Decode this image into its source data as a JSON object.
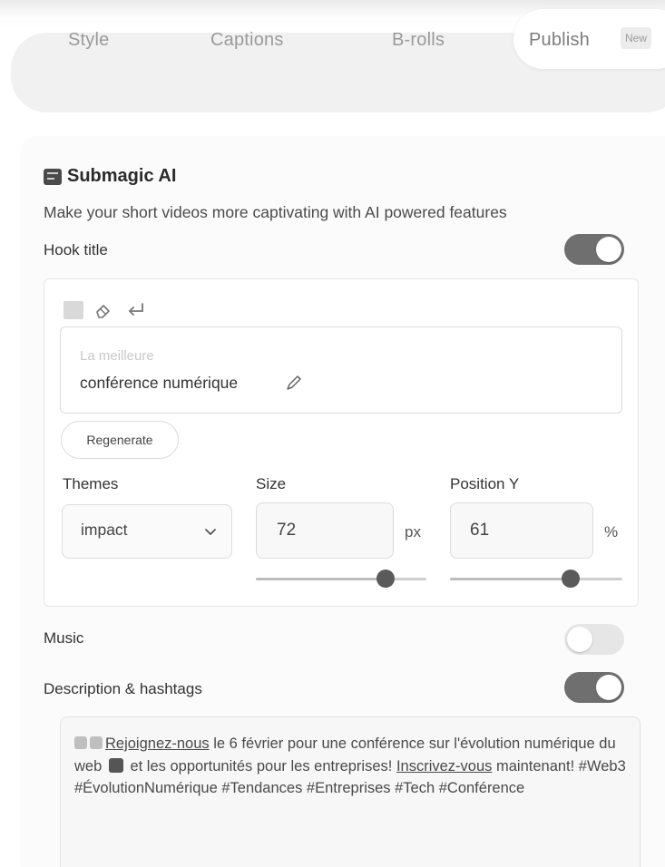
{
  "tabs": {
    "style": "Style",
    "captions": "Captions",
    "brolls": "B-rolls",
    "publish": "Publish",
    "publish_badge": "New"
  },
  "ai": {
    "title": "Submagic AI",
    "subtitle": "Make your short videos more captivating with AI powered features"
  },
  "hook": {
    "label": "Hook title",
    "enabled": true,
    "line1": "La meilleure",
    "line2": "conférence numérique",
    "regenerate": "Regenerate",
    "themes_label": "Themes",
    "theme_value": "impact",
    "size_label": "Size",
    "size_value": "72",
    "size_unit": "px",
    "size_slider": 0.76,
    "posy_label": "Position Y",
    "posy_value": "61",
    "posy_unit": "%",
    "posy_slider": 0.7
  },
  "music": {
    "label": "Music",
    "enabled": false
  },
  "description": {
    "label": "Description & hashtags",
    "enabled": true,
    "p1": "Rejoignez-nous",
    "p2": " le 6 février pour une conférence sur l'évolution numérique du web ",
    "p3": " et les opportunités pour les entreprises! ",
    "p4": "Inscrivez-vous",
    "p5": " maintenant! #Web3 #ÉvolutionNumérique #Tendances #Entreprises #Tech #Conférence"
  },
  "icons": [
    "submagic-icon",
    "color-swatch-icon",
    "eraser-icon",
    "enter-icon",
    "pen-icon",
    "chevron-down-icon"
  ],
  "colors": {
    "toggle_on": "#6f6f6f",
    "toggle_off": "#e6e6e6",
    "slider_thumb": "#5a5a5a"
  }
}
